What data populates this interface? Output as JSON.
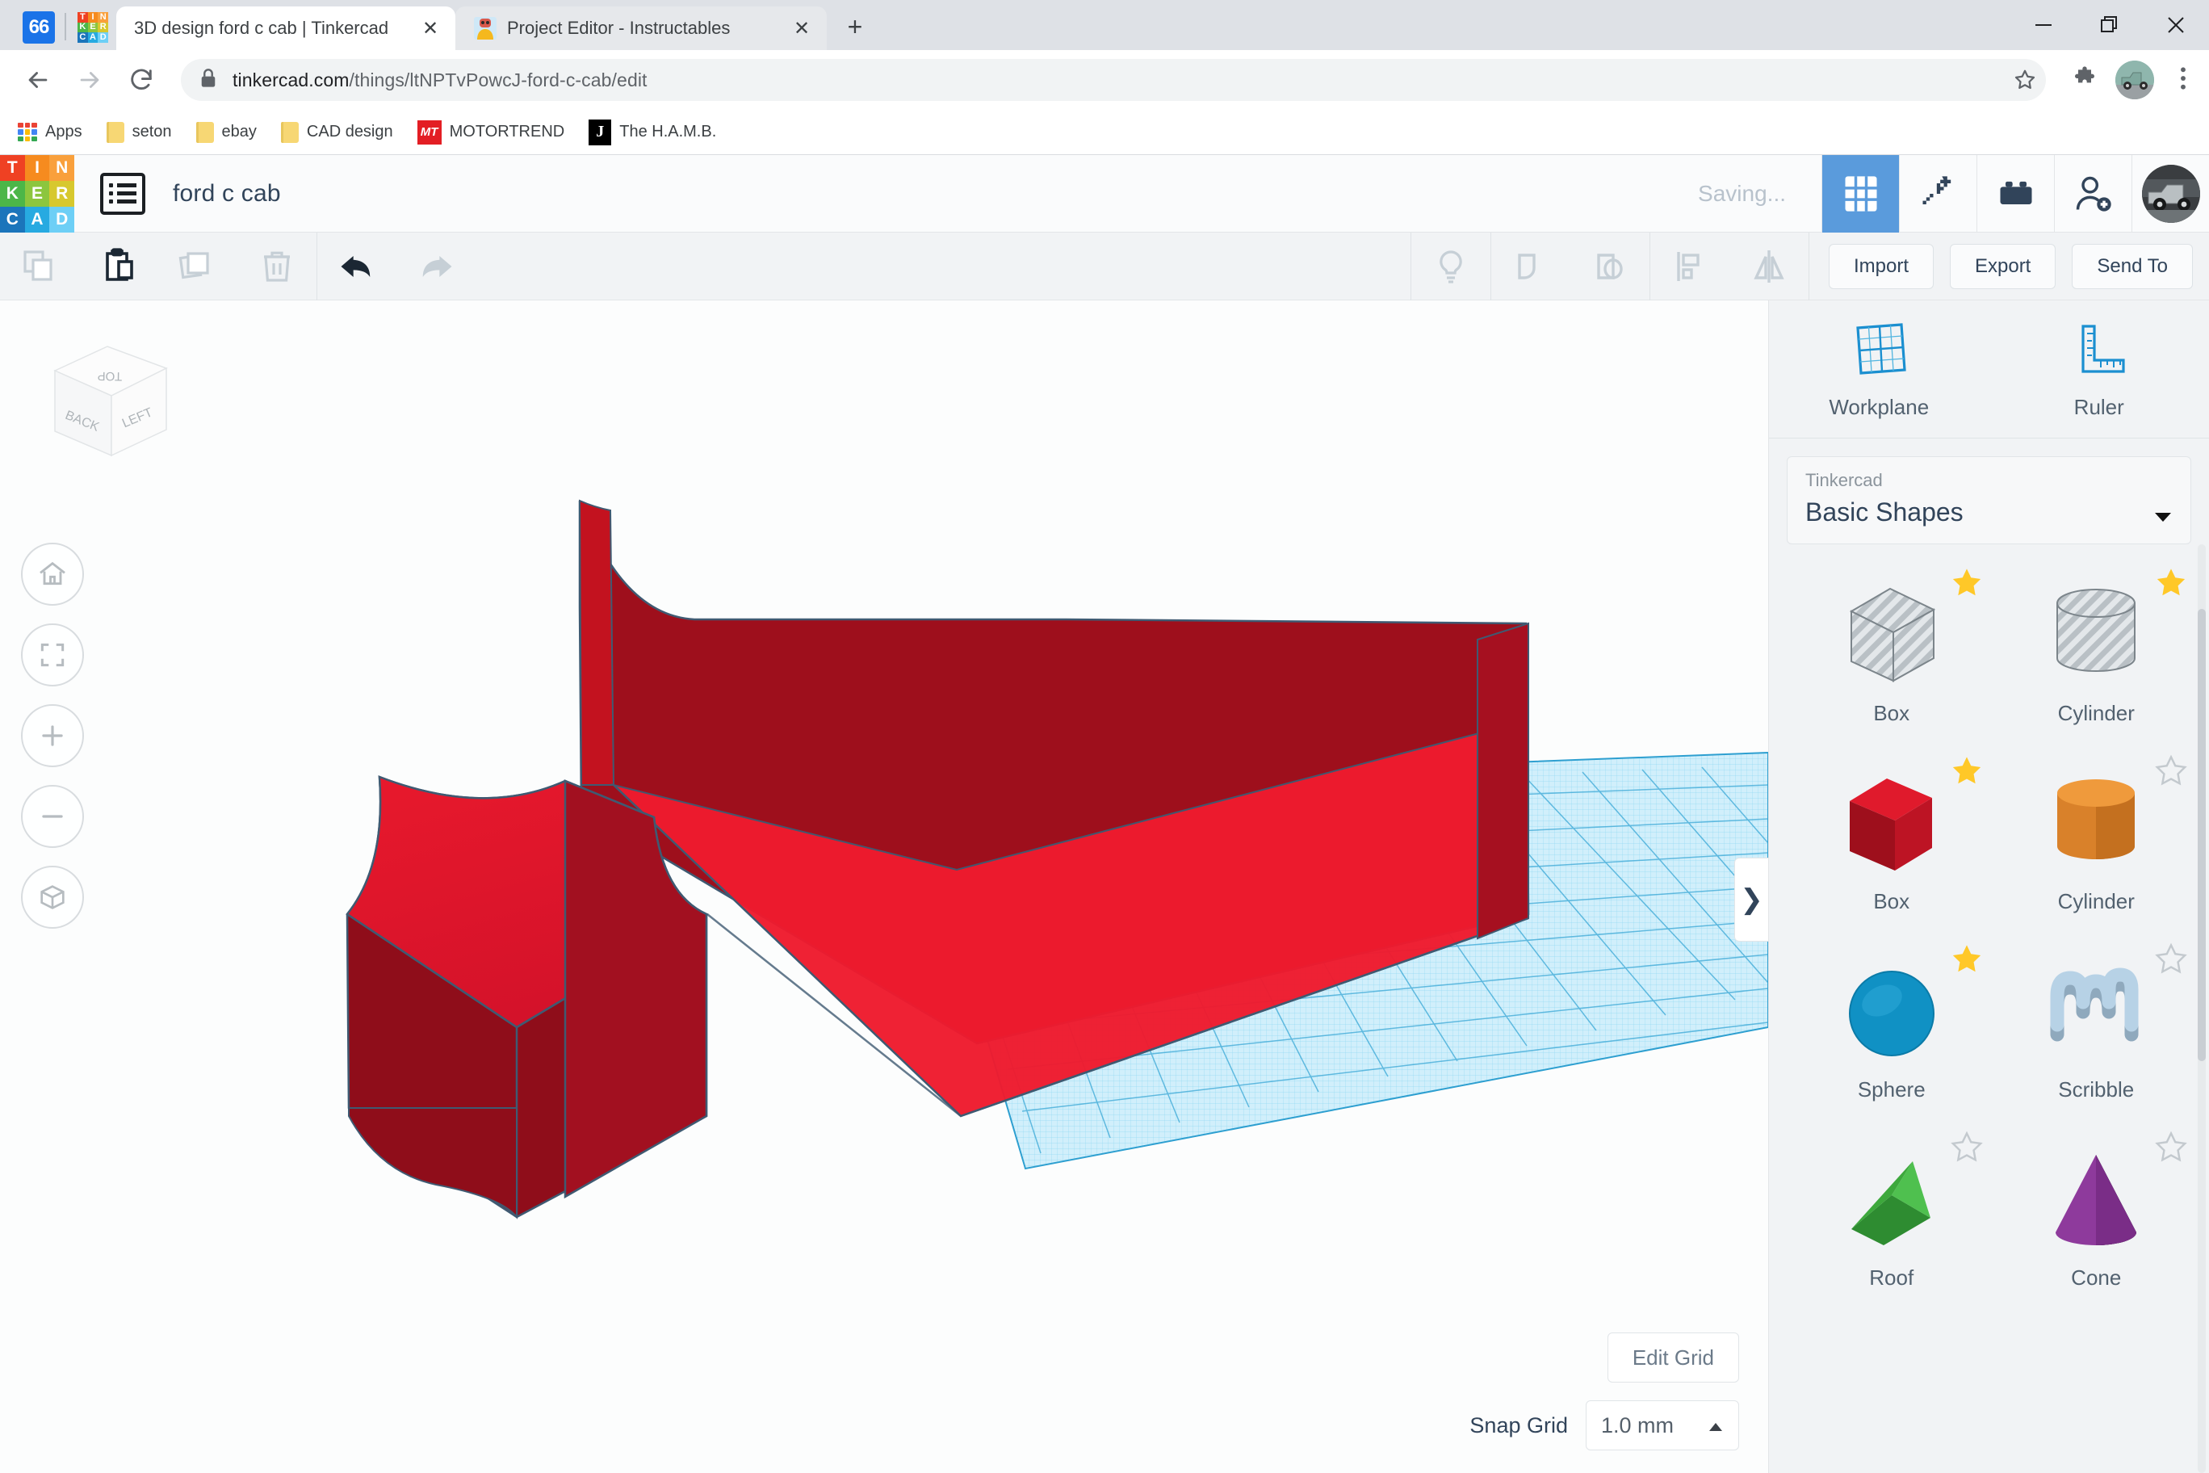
{
  "browser": {
    "site_badge": "66",
    "tabs": [
      {
        "title": "3D design ford c cab | Tinkercad",
        "active": true,
        "favicon": "tinkercad-logo-icon"
      },
      {
        "title": "Project Editor - Instructables",
        "active": false,
        "favicon": "instructables-robot-icon"
      }
    ],
    "new_tab_label": "+",
    "window_controls": {
      "minimize": "minimize-icon",
      "maximize": "restore-icon",
      "close": "close-icon"
    },
    "nav": {
      "back": "back-arrow-icon",
      "forward": "forward-arrow-icon",
      "reload": "reload-icon"
    },
    "omnibox": {
      "lock": "lock-icon",
      "url_domain": "tinkercad.com",
      "url_path": "/things/ltNPTvPowcJ-ford-c-cab/edit",
      "bookmark_star": "star-icon"
    },
    "extensions_icon": "puzzle-piece-icon",
    "profile_icon": "profile-avatar",
    "menu_icon": "three-dots-menu-icon",
    "bookmarks": [
      {
        "label": "Apps",
        "icon": "apps-grid-icon"
      },
      {
        "label": "seton",
        "icon": "folder-icon"
      },
      {
        "label": "ebay",
        "icon": "folder-icon"
      },
      {
        "label": "CAD design",
        "icon": "folder-icon"
      },
      {
        "label": "MOTORTREND",
        "icon": "motortrend-icon"
      },
      {
        "label": "The H.A.M.B.",
        "icon": "jalopy-journal-icon"
      }
    ]
  },
  "app": {
    "logo_letters": [
      "T",
      "I",
      "N",
      "K",
      "E",
      "R",
      "C",
      "A",
      "D"
    ],
    "design_list_icon": "design-list-icon",
    "document_title": "ford c cab",
    "save_status": "Saving...",
    "header_buttons": [
      {
        "name": "blocks-view",
        "icon": "grid-3x3-icon",
        "active": true
      },
      {
        "name": "minecraft-view",
        "icon": "pickaxe-icon",
        "active": false
      },
      {
        "name": "bricks-view",
        "icon": "lego-brick-icon",
        "active": false
      },
      {
        "name": "invite-people",
        "icon": "add-person-icon",
        "active": false
      }
    ],
    "avatar": "user-avatar",
    "toolbar": {
      "copy": {
        "label": "Copy",
        "icon": "copy-icon",
        "enabled": false
      },
      "paste": {
        "label": "Paste",
        "icon": "paste-icon",
        "enabled": true
      },
      "duplicate": {
        "label": "Duplicate",
        "icon": "duplicate-icon",
        "enabled": false
      },
      "delete": {
        "label": "Delete",
        "icon": "trash-icon",
        "enabled": false
      },
      "undo": {
        "label": "Undo",
        "icon": "undo-arrow-icon",
        "enabled": true
      },
      "redo": {
        "label": "Redo",
        "icon": "redo-arrow-icon",
        "enabled": false
      },
      "hint": {
        "label": "Hint",
        "icon": "lightbulb-icon"
      },
      "group": {
        "label": "Group",
        "icon": "group-shapes-icon"
      },
      "ungroup": {
        "label": "Ungroup",
        "icon": "ungroup-shapes-icon"
      },
      "align": {
        "label": "Align",
        "icon": "align-icon"
      },
      "mirror": {
        "label": "Mirror",
        "icon": "mirror-icon"
      },
      "import_label": "Import",
      "export_label": "Export",
      "send_to_label": "Send To"
    },
    "canvas": {
      "view_cube": {
        "top": "TOP",
        "back": "BACK",
        "left": "LEFT"
      },
      "nav_buttons": [
        {
          "name": "home-view-button",
          "icon": "home-icon"
        },
        {
          "name": "fit-to-view-button",
          "icon": "fit-frame-icon"
        },
        {
          "name": "zoom-in-button",
          "icon": "plus-icon"
        },
        {
          "name": "zoom-out-button",
          "icon": "minus-icon"
        },
        {
          "name": "perspective-toggle-button",
          "icon": "cube-ortho-icon"
        }
      ],
      "edit_grid_label": "Edit Grid",
      "snap_grid_label": "Snap Grid",
      "snap_grid_value": "1.0 mm",
      "snap_grid_caret": "caret-up-icon",
      "panel_toggle_icon": "chevron-right-icon",
      "model_color": "#c3121f",
      "workplane_color": "#9fdcf2"
    },
    "panel": {
      "workplane_label": "Workplane",
      "workplane_icon": "workplane-grid-icon",
      "ruler_label": "Ruler",
      "ruler_icon": "ruler-icon",
      "library_owner": "Tinkercad",
      "library_name": "Basic Shapes",
      "dropdown_icon": "caret-down-icon",
      "shapes": [
        {
          "label": "Box",
          "kind": "hole-box",
          "starred": true,
          "color": "#c9ced3"
        },
        {
          "label": "Cylinder",
          "kind": "hole-cylinder",
          "starred": true,
          "color": "#c9ced3"
        },
        {
          "label": "Box",
          "kind": "box",
          "starred": true,
          "color": "#c9182a"
        },
        {
          "label": "Cylinder",
          "kind": "cylinder",
          "starred": false,
          "color": "#e5892a"
        },
        {
          "label": "Sphere",
          "kind": "sphere",
          "starred": true,
          "color": "#1091c4"
        },
        {
          "label": "Scribble",
          "kind": "scribble",
          "starred": false,
          "color": "#a8c4d8"
        },
        {
          "label": "Roof",
          "kind": "roof",
          "starred": false,
          "color": "#49a942"
        },
        {
          "label": "Cone",
          "kind": "cone",
          "starred": false,
          "color": "#8e3a9c"
        }
      ]
    }
  },
  "colors": {
    "accent_blue": "#5a9bdc",
    "tinkercad_blue": "#1b8fd0",
    "text_dark": "#31445a",
    "panel_bg": "#f1f3f5",
    "toolbar_bg": "#f1f3f5"
  }
}
